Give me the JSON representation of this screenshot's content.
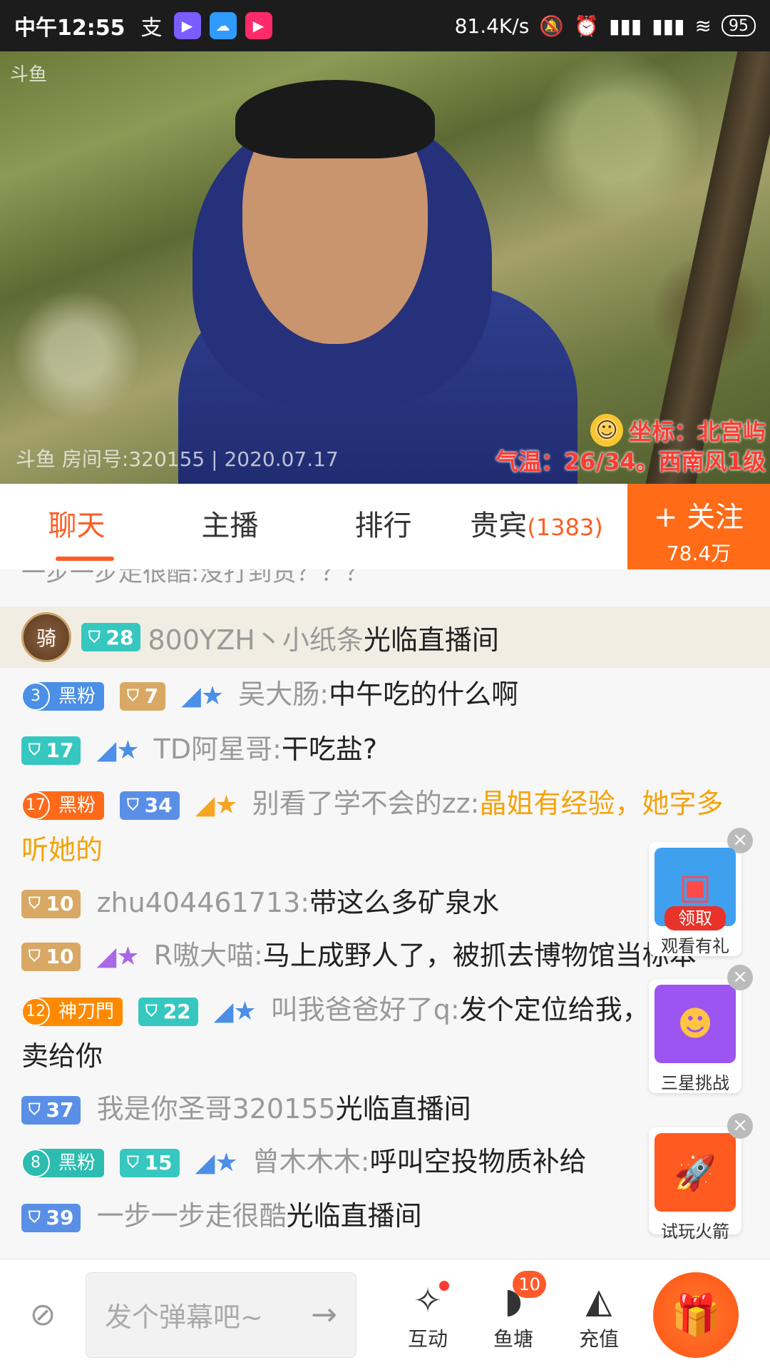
{
  "status_bar": {
    "time": "中午12:55",
    "speed": "81.4K/s",
    "battery": "95"
  },
  "video": {
    "watermark": "斗鱼",
    "room_info": "斗鱼 房间号:320155 | 2020.07.17",
    "coord_text": "坐标：北宫屿",
    "temp_text": "气温：26/34。西南风1级"
  },
  "tabs": [
    {
      "label": "聊天"
    },
    {
      "label": "主播"
    },
    {
      "label": "排行"
    },
    {
      "label": "贵宾",
      "count": "(1383)"
    }
  ],
  "follow": {
    "label": "+ 关注",
    "count": "78.4万"
  },
  "chat": {
    "partial_top": "一步一步走很酷:没打到货？？？",
    "knight": {
      "icon_text": "骑",
      "level": "28",
      "user": "800YZH丶小纸条",
      "text": "光临直播间"
    },
    "messages": [
      {
        "fan_level": "3",
        "fan_name": "黑粉",
        "level": "7",
        "user": "吴大肠:",
        "text": "中午吃的什么啊"
      },
      {
        "level": "17",
        "user": "TD阿星哥:",
        "text": "干吃盐?"
      },
      {
        "fan_level": "17",
        "fan_name": "黑粉",
        "level": "34",
        "user": "别看了学不会的zz:",
        "text": "晶姐有经验，她字多听她的"
      },
      {
        "level": "10",
        "user": "zhu404461713:",
        "text": "带这么多矿泉水"
      },
      {
        "level": "10",
        "user": "R嗷大喵:",
        "text": "马上成野人了，被抓去博物馆当标本"
      },
      {
        "fan_level": "12",
        "fan_name": "神刀門",
        "level": "22",
        "user": "叫我爸爸好了q:",
        "text": "发个定位给我，点个外卖给你"
      },
      {
        "level": "37",
        "user": "我是你圣哥320155",
        "text": "光临直播间"
      },
      {
        "fan_level": "8",
        "fan_name": "黑粉",
        "level": "15",
        "user": "曾木木木:",
        "text": "呼叫空投物质补给"
      },
      {
        "level": "39",
        "user": "一步一步走很酷",
        "text": "光临直播间"
      }
    ]
  },
  "floaters": [
    {
      "badge": "领取",
      "label": "观看有礼"
    },
    {
      "label": "三星挑战"
    },
    {
      "label": "试玩火箭"
    }
  ],
  "bottom": {
    "danmu_placeholder": "发个弹幕吧~",
    "interact_label": "互动",
    "fishpond_label": "鱼塘",
    "fishpond_count": "10",
    "recharge_label": "充值"
  }
}
